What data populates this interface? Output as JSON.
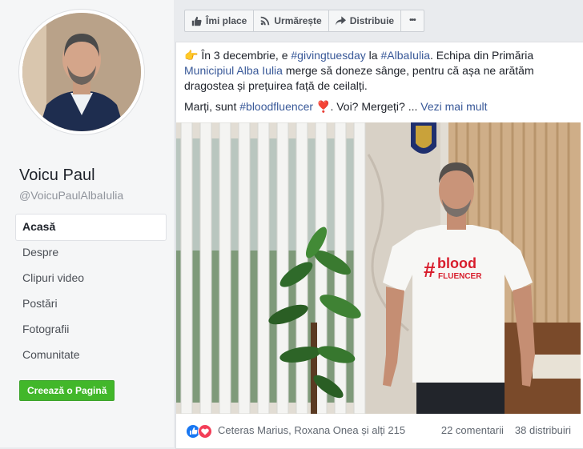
{
  "profile": {
    "name": "Voicu Paul",
    "handle": "@VoicuPaulAlbaIulia"
  },
  "sidebar": {
    "items": [
      {
        "label": "Acasă"
      },
      {
        "label": "Despre"
      },
      {
        "label": "Clipuri video"
      },
      {
        "label": "Postări"
      },
      {
        "label": "Fotografii"
      },
      {
        "label": "Comunitate"
      }
    ],
    "create_page": "Creează o Pagină"
  },
  "actions": {
    "like": "Îmi place",
    "follow": "Urmărește",
    "share": "Distribuie",
    "more": "•••"
  },
  "post": {
    "line1_emoji": "👉",
    "line1_a": " În 3 decembrie, e ",
    "hashtag1": "#givingtuesday",
    "line1_b": " la ",
    "hashtag2": "#AlbaIulia",
    "line1_c": ". Echipa din Primăria ",
    "mention": "Municipiul Alba Iulia",
    "line1_d": " merge să doneze sânge, pentru că așa ne arătăm dragostea și prețuirea față de ceilalți.",
    "line2_a": "Marți, sunt ",
    "hashtag3": "#bloodfluencer",
    "heart": "❣️",
    "line2_b": ". Voi? Mergeți? ... ",
    "see_more": "Vezi mai mult"
  },
  "photo": {
    "tshirt_hash": "#",
    "tshirt_word": "blood",
    "tshirt_sub": "FLUENCER"
  },
  "reactions": {
    "names": "Ceteras Marius, Roxana Onea și alți 215",
    "comments": "22 comentarii",
    "shares": "38 distribuiri"
  },
  "colors": {
    "accent_blue": "#385898",
    "create_green": "#42b72a",
    "like_blue": "#1877f2",
    "love_red": "#f33e58",
    "tshirt_red": "#d81d2c"
  }
}
